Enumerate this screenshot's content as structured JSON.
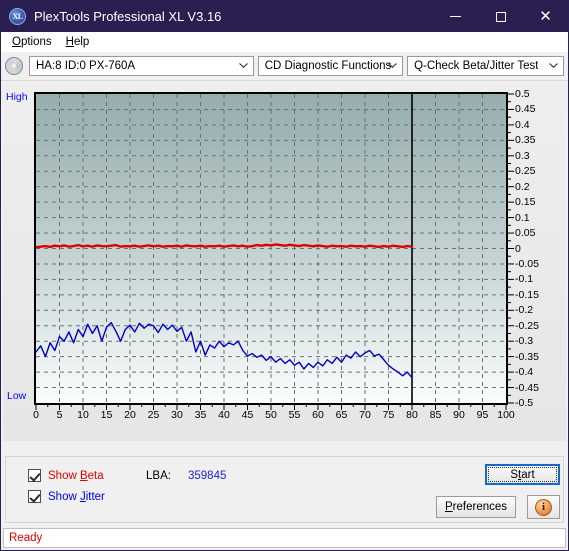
{
  "window": {
    "title": "PlexTools Professional XL V3.16",
    "icon": "XL",
    "minimize_label": "minimize",
    "maximize_label": "maximize",
    "close_label": "✕"
  },
  "menubar": {
    "items": [
      {
        "label": "Options",
        "accel": "O"
      },
      {
        "label": "Help",
        "accel": "H"
      }
    ]
  },
  "toolbar": {
    "drive_icon": "disc-icon",
    "drive_combo": {
      "value": "HA:8 ID:0  PX-760A"
    },
    "function_combo": {
      "value": "CD Diagnostic Functions"
    },
    "test_combo": {
      "value": "Q-Check Beta/Jitter Test"
    }
  },
  "chart_data": {
    "type": "line",
    "title": "Q-Check Beta/Jitter Test",
    "xlabel": "",
    "ylabel": "",
    "xlim": [
      0,
      100
    ],
    "ylim": [
      -0.5,
      0.5
    ],
    "grid": true,
    "legend": "none",
    "high_label": "High",
    "low_label": "Low",
    "x_ticks": [
      0,
      5,
      10,
      15,
      20,
      25,
      30,
      35,
      40,
      45,
      50,
      55,
      60,
      65,
      70,
      75,
      80,
      85,
      90,
      95,
      100
    ],
    "y_ticks": [
      0.5,
      0.45,
      0.4,
      0.35,
      0.3,
      0.25,
      0.2,
      0.15,
      0.1,
      0.05,
      0,
      -0.05,
      -0.1,
      -0.15,
      -0.2,
      -0.25,
      -0.3,
      -0.35,
      -0.4,
      -0.45,
      -0.5
    ],
    "data_end_x": 80,
    "series": [
      {
        "name": "Beta",
        "color": "#e00000",
        "x": [
          0,
          1,
          2,
          3,
          4,
          5,
          6,
          7,
          8,
          9,
          10,
          11,
          12,
          13,
          14,
          15,
          16,
          17,
          18,
          19,
          20,
          21,
          22,
          23,
          24,
          25,
          26,
          27,
          28,
          29,
          30,
          31,
          32,
          33,
          34,
          35,
          36,
          37,
          38,
          39,
          40,
          41,
          42,
          43,
          44,
          45,
          46,
          47,
          48,
          49,
          50,
          51,
          52,
          53,
          54,
          55,
          56,
          57,
          58,
          59,
          60,
          61,
          62,
          63,
          64,
          65,
          66,
          67,
          68,
          69,
          70,
          71,
          72,
          73,
          74,
          75,
          76,
          77,
          78,
          79,
          80
        ],
        "values": [
          0.004,
          0.006,
          0.008,
          0.005,
          0.009,
          0.007,
          0.01,
          0.006,
          0.008,
          0.011,
          0.007,
          0.009,
          0.006,
          0.01,
          0.008,
          0.007,
          0.009,
          0.011,
          0.006,
          0.008,
          0.007,
          0.009,
          0.006,
          0.008,
          0.01,
          0.007,
          0.009,
          0.006,
          0.008,
          0.007,
          0.009,
          0.006,
          0.01,
          0.008,
          0.007,
          0.009,
          0.006,
          0.008,
          0.007,
          0.009,
          0.006,
          0.008,
          0.01,
          0.007,
          0.009,
          0.006,
          0.008,
          0.011,
          0.009,
          0.012,
          0.01,
          0.013,
          0.011,
          0.009,
          0.012,
          0.01,
          0.008,
          0.011,
          0.009,
          0.007,
          0.01,
          0.008,
          0.006,
          0.009,
          0.007,
          0.008,
          0.006,
          0.009,
          0.007,
          0.008,
          0.006,
          0.009,
          0.007,
          0.005,
          0.008,
          0.006,
          0.009,
          0.007,
          0.005,
          0.008,
          0.006
        ]
      },
      {
        "name": "Jitter",
        "color": "#0000cc",
        "x": [
          0,
          1,
          2,
          3,
          4,
          5,
          6,
          7,
          8,
          9,
          10,
          11,
          12,
          13,
          14,
          15,
          16,
          17,
          18,
          19,
          20,
          21,
          22,
          23,
          24,
          25,
          26,
          27,
          28,
          29,
          30,
          31,
          32,
          33,
          34,
          35,
          36,
          37,
          38,
          39,
          40,
          41,
          42,
          43,
          44,
          45,
          46,
          47,
          48,
          49,
          50,
          51,
          52,
          53,
          54,
          55,
          56,
          57,
          58,
          59,
          60,
          61,
          62,
          63,
          64,
          65,
          66,
          67,
          68,
          69,
          70,
          71,
          72,
          73,
          74,
          75,
          76,
          77,
          78,
          79,
          80
        ],
        "values": [
          -0.335,
          -0.315,
          -0.35,
          -0.305,
          -0.33,
          -0.285,
          -0.3,
          -0.27,
          -0.305,
          -0.262,
          -0.285,
          -0.245,
          -0.275,
          -0.25,
          -0.3,
          -0.255,
          -0.24,
          -0.268,
          -0.3,
          -0.262,
          -0.248,
          -0.27,
          -0.242,
          -0.258,
          -0.245,
          -0.25,
          -0.272,
          -0.245,
          -0.262,
          -0.248,
          -0.268,
          -0.255,
          -0.3,
          -0.27,
          -0.335,
          -0.3,
          -0.345,
          -0.312,
          -0.322,
          -0.3,
          -0.318,
          -0.305,
          -0.312,
          -0.3,
          -0.33,
          -0.348,
          -0.34,
          -0.352,
          -0.345,
          -0.362,
          -0.35,
          -0.368,
          -0.356,
          -0.372,
          -0.36,
          -0.378,
          -0.368,
          -0.39,
          -0.372,
          -0.385,
          -0.368,
          -0.38,
          -0.36,
          -0.372,
          -0.352,
          -0.368,
          -0.345,
          -0.355,
          -0.335,
          -0.35,
          -0.338,
          -0.33,
          -0.348,
          -0.342,
          -0.36,
          -0.378,
          -0.39,
          -0.4,
          -0.412,
          -0.4,
          -0.418
        ]
      }
    ]
  },
  "controls": {
    "show_beta": {
      "label": "Show ",
      "accel": "B",
      "rest": "eta",
      "checked": true
    },
    "show_jitter": {
      "label": "Show ",
      "accel": "J",
      "rest": "itter",
      "checked": true
    },
    "lba_label": "LBA:",
    "lba_value": "359845",
    "start_button": {
      "label": "S",
      "accel": "t",
      "rest": "art"
    },
    "preferences_button": {
      "label": "P",
      "accel": "r",
      "rest": "eferences"
    },
    "info_button": {
      "icon": "info-icon",
      "glyph": "i"
    }
  },
  "statusbar": {
    "text": "Ready"
  }
}
